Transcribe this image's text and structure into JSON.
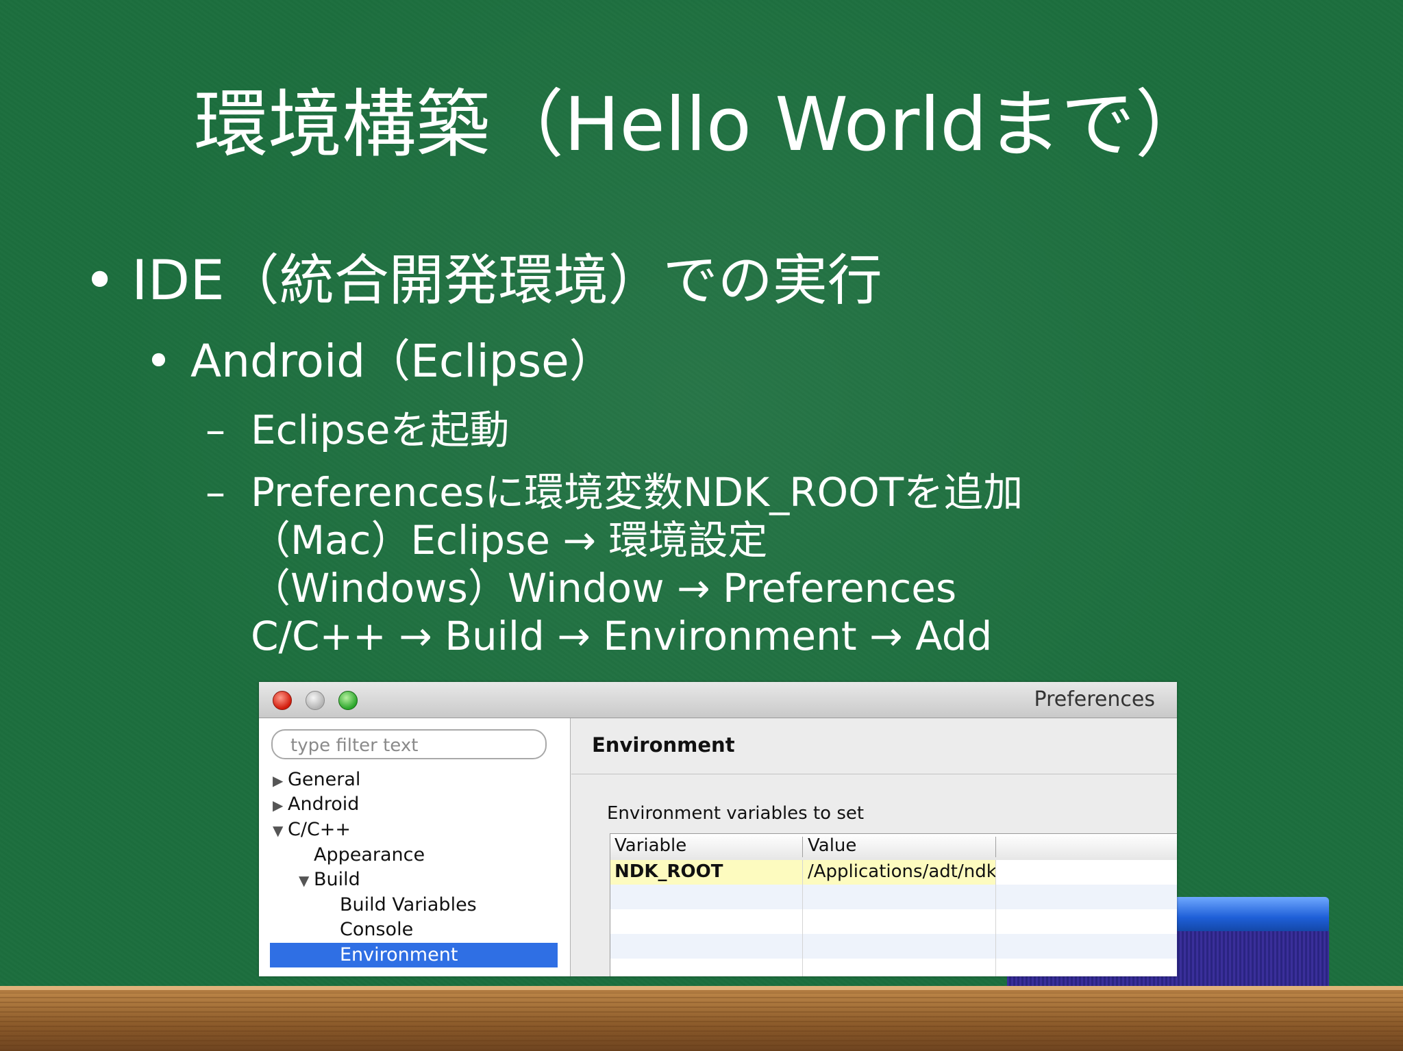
{
  "slide": {
    "title": "環境構築（Hello Worldまで）",
    "bullet1": "IDE（統合開発環境）での実行",
    "bullet2": "Android（Eclipse）",
    "dash1": "Eclipseを起動",
    "dash2_line1": "Preferencesに環境変数NDK_ROOTを追加",
    "dash2_line2": "（Mac）Eclipse → 環境設定",
    "dash2_line3": "（Windows）Window → Preferences",
    "dash2_line4": "C/C++ → Build → Environment → Add",
    "bullet_symbol": "•",
    "dash_symbol": "–"
  },
  "window": {
    "title": "Preferences",
    "filter_placeholder": "type filter text",
    "tree": [
      {
        "label": "General",
        "expanded": false
      },
      {
        "label": "Android",
        "expanded": false
      },
      {
        "label": "C/C++",
        "expanded": true
      },
      {
        "label": "Appearance"
      },
      {
        "label": "Build",
        "expanded": true
      },
      {
        "label": "Build Variables"
      },
      {
        "label": "Console"
      },
      {
        "label": "Environment",
        "selected": true
      }
    ],
    "arrow_collapsed": "▶",
    "arrow_expanded": "▼",
    "page_heading": "Environment",
    "section_label": "Environment variables to set",
    "table": {
      "columns": [
        "Variable",
        "Value"
      ],
      "rows": [
        {
          "variable": "NDK_ROOT",
          "value": "/Applications/adt/ndk"
        }
      ]
    }
  },
  "colors": {
    "board": "#1c6e3e",
    "selection": "#2f6fe4",
    "row_highlight": "#fdfbbf"
  }
}
